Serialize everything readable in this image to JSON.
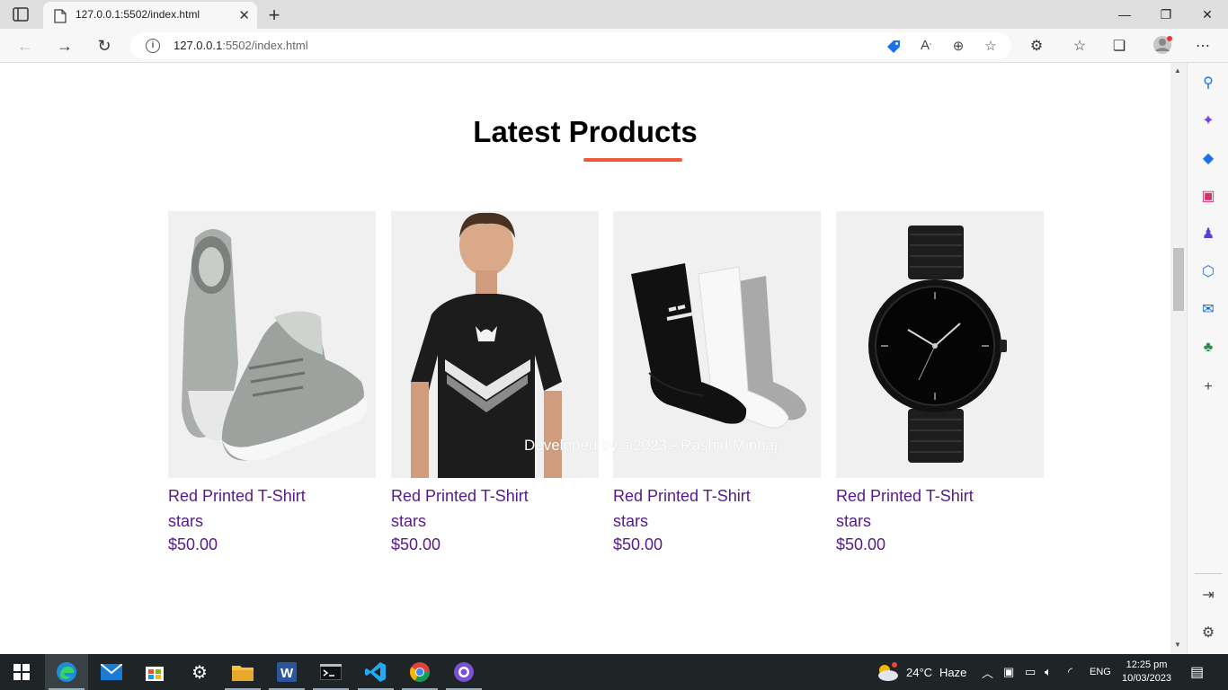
{
  "browser": {
    "tab_title": "127.0.0.1:5502/index.html",
    "url_host": "127.0.0.1",
    "url_rest": ":5502/index.html"
  },
  "page": {
    "heading": "Latest Products",
    "accent_color": "#f05a3a",
    "link_color": "#551a8b",
    "products": [
      {
        "name": "Red Printed T-Shirt",
        "stars": "stars",
        "price": "$50.00",
        "image": "grey-sneakers"
      },
      {
        "name": "Red Printed T-Shirt",
        "stars": "stars",
        "price": "$50.00",
        "image": "black-tshirt-model"
      },
      {
        "name": "Red Printed T-Shirt",
        "stars": "stars",
        "price": "$50.00",
        "image": "socks-set"
      },
      {
        "name": "Red Printed T-Shirt",
        "stars": "stars",
        "price": "$50.00",
        "image": "black-wristwatch"
      }
    ],
    "credit": "Developed by@2023 - Rashid Minhaj"
  },
  "taskbar": {
    "weather_temp": "24°C",
    "weather_desc": "Haze",
    "language": "ENG",
    "time": "12:25 pm",
    "date": "10/03/2023"
  }
}
